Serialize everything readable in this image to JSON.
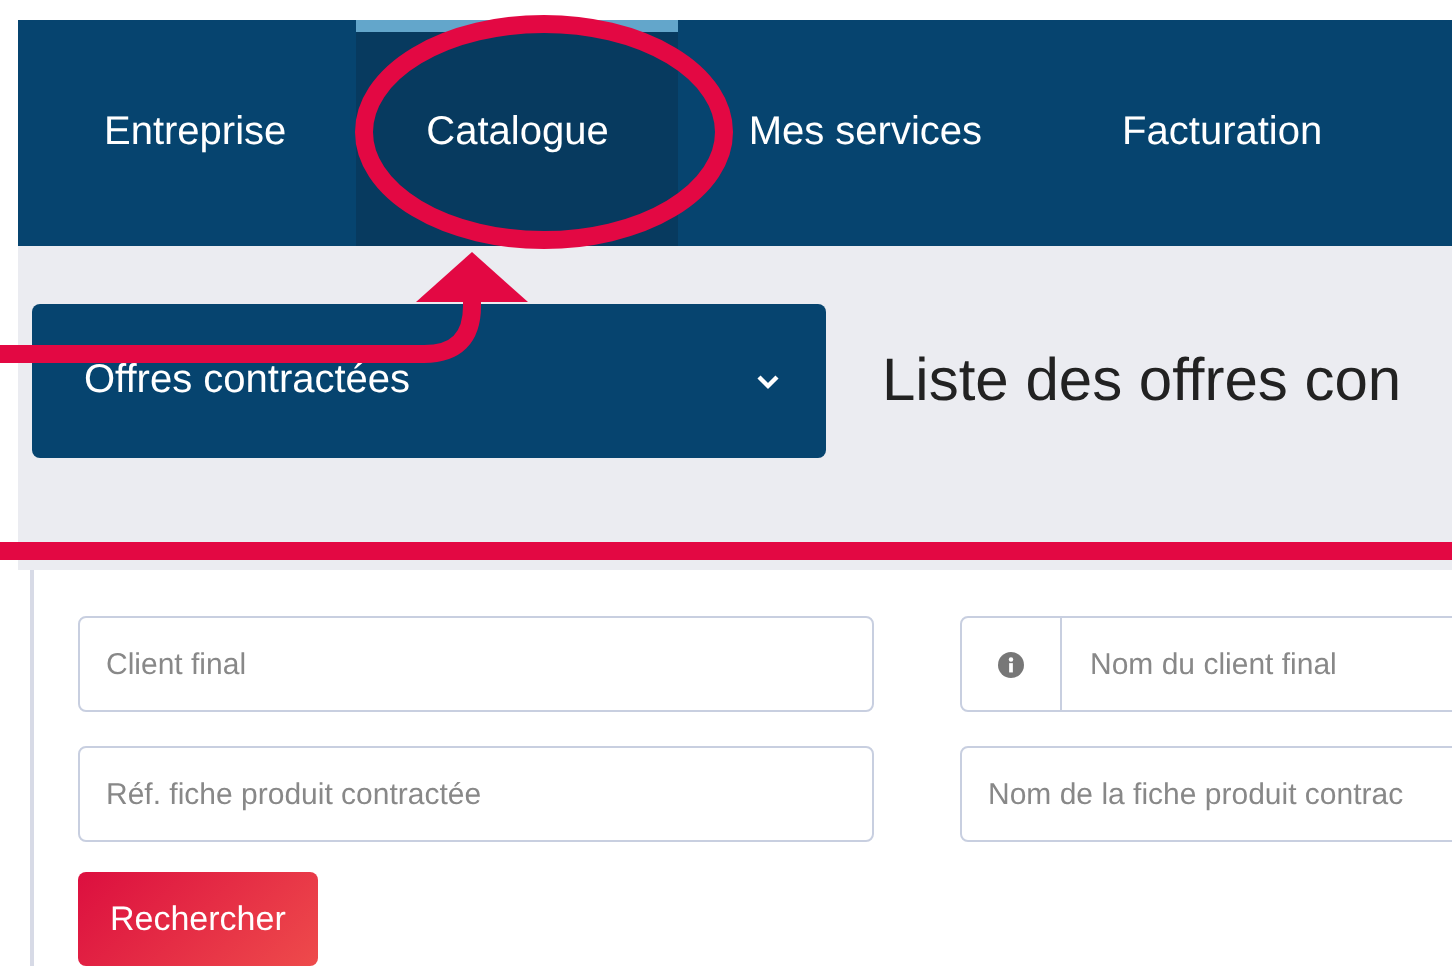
{
  "nav": {
    "tabs": [
      {
        "label": "Entreprise",
        "selected": false
      },
      {
        "label": "Catalogue",
        "selected": true
      },
      {
        "label": "Mes services",
        "selected": false
      },
      {
        "label": "Facturation",
        "selected": false
      }
    ]
  },
  "section_dropdown": {
    "value": "Offres contractées"
  },
  "heading": "Liste des offres con",
  "filters": {
    "rows": [
      [
        {
          "placeholder": "Client final",
          "info": false
        },
        {
          "placeholder": "Nom du client final",
          "info": true
        }
      ],
      [
        {
          "placeholder": "Réf. fiche produit contractée",
          "info": false
        },
        {
          "placeholder": "Nom de la fiche produit contrac",
          "info": false
        }
      ]
    ]
  },
  "search_button": "Rechercher"
}
